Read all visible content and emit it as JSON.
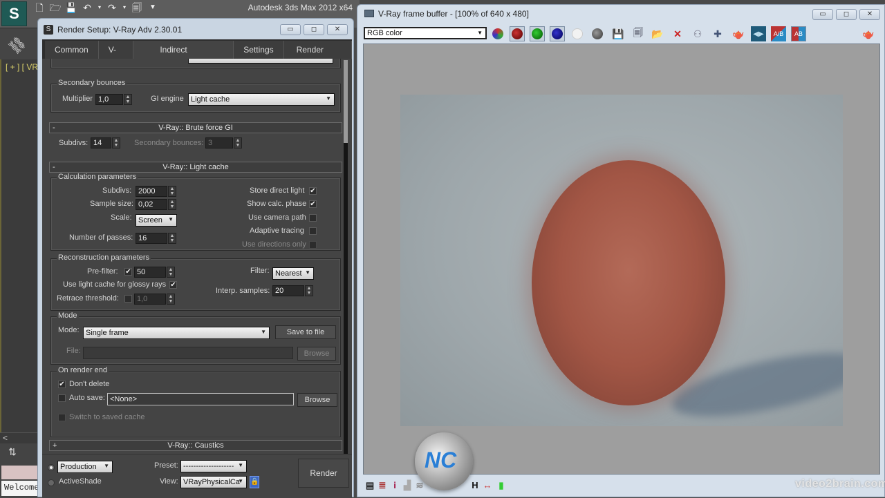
{
  "max": {
    "app_title": "Autodesk 3ds Max  2012 x64",
    "logo_icon": "3dsmax-logo-icon",
    "quick_access": [
      "new-file-icon",
      "open-file-icon",
      "save-icon",
      "undo-icon",
      "redo-icon",
      "project-folder-icon",
      "customize-dropdown-icon"
    ],
    "viewport_label": "[ + ] [ VRa",
    "scroll_left": "<",
    "welcome_text": "Welcome"
  },
  "render_setup": {
    "title": "Render Setup: V-Ray Adv 2.30.01",
    "win_buttons": {
      "minimize": "▭",
      "maximize": "◻",
      "close": "✕"
    },
    "tabs": [
      {
        "label": "Common"
      },
      {
        "label": "V-Ray"
      },
      {
        "label": "Indirect illumination",
        "active": true
      },
      {
        "label": "Settings"
      },
      {
        "label": "Render Elements"
      }
    ],
    "secondary_bounces": {
      "group_label": "Secondary bounces",
      "multiplier_label": "Multiplier",
      "multiplier_value": "1,0",
      "gi_engine_label": "GI engine",
      "gi_engine_value": "Light cache"
    },
    "brute_force": {
      "header": "V-Ray:: Brute force GI",
      "toggle": "-",
      "subdivs_label": "Subdivs:",
      "subdivs_value": "14",
      "sec_bounces_label": "Secondary bounces:",
      "sec_bounces_value": "3"
    },
    "light_cache": {
      "header": "V-Ray:: Light cache",
      "toggle": "-",
      "calc_group": "Calculation parameters",
      "subdivs_label": "Subdivs:",
      "subdivs_value": "2000",
      "sample_size_label": "Sample size:",
      "sample_size_value": "0,02",
      "scale_label": "Scale:",
      "scale_value": "Screen",
      "passes_label": "Number of passes:",
      "passes_value": "16",
      "store_direct_label": "Store direct light",
      "store_direct_checked": true,
      "show_calc_label": "Show calc. phase",
      "show_calc_checked": true,
      "camera_path_label": "Use camera path",
      "camera_path_checked": false,
      "adaptive_label": "Adaptive tracing",
      "adaptive_checked": false,
      "directions_label": "Use directions only",
      "directions_checked": false,
      "recon_group": "Reconstruction parameters",
      "prefilter_label": "Pre-filter:",
      "prefilter_checked": true,
      "prefilter_value": "50",
      "glossy_label": "Use light cache for glossy rays",
      "glossy_checked": true,
      "retrace_label": "Retrace threshold:",
      "retrace_checked": false,
      "retrace_value": "1,0",
      "filter_label": "Filter:",
      "filter_value": "Nearest",
      "interp_label": "Interp. samples:",
      "interp_value": "20",
      "mode_group": "Mode",
      "mode_label": "Mode:",
      "mode_value": "Single frame",
      "save_to_file": "Save to file",
      "file_label": "File:",
      "file_value": "",
      "browse": "Browse",
      "render_end_group": "On render end",
      "dont_delete_label": "Don't delete",
      "dont_delete_checked": true,
      "auto_save_label": "Auto save:",
      "auto_save_checked": false,
      "auto_save_value": "<None>",
      "browse2": "Browse",
      "switch_label": "Switch to saved cache",
      "switch_checked": false
    },
    "caustics": {
      "header": "V-Ray:: Caustics",
      "toggle": "+"
    },
    "bottom": {
      "production_selected": true,
      "production_value": "Production",
      "activeshade_label": "ActiveShade",
      "preset_label": "Preset:",
      "preset_value": "--------------------",
      "view_label": "View:",
      "view_value": "VRayPhysicalCa",
      "render_label": "Render",
      "lock_icon": "lock-icon"
    }
  },
  "vfb": {
    "title": "V-Ray frame buffer - [100% of 640 x 480]",
    "channel_value": "RGB color",
    "toolbar": [
      "rgb-channels-icon",
      "red-channel-icon",
      "green-channel-icon",
      "blue-channel-icon",
      "alpha-channel-icon",
      "monochrome-icon",
      "save-image-icon",
      "save-all-icon",
      "load-image-icon",
      "clear-image-icon",
      "track-mouse-icon",
      "region-render-icon",
      "render-last-icon",
      "ab-compare-horizontal-icon",
      "ab-compare-icon",
      "ab-compare-vertical-icon",
      "render-teapot-icon"
    ],
    "bottom_toolbar": [
      "color-correction-icon",
      "levels-icon",
      "info-icon",
      "histogram-icon",
      "curve-icon",
      "exposure-icon",
      "lut-icon",
      "h-flip-icon",
      "stereo-icon",
      "pixel-aspect-icon"
    ],
    "info_glyph": "i",
    "h_glyph": "H",
    "watermark": "video2brain.com"
  }
}
